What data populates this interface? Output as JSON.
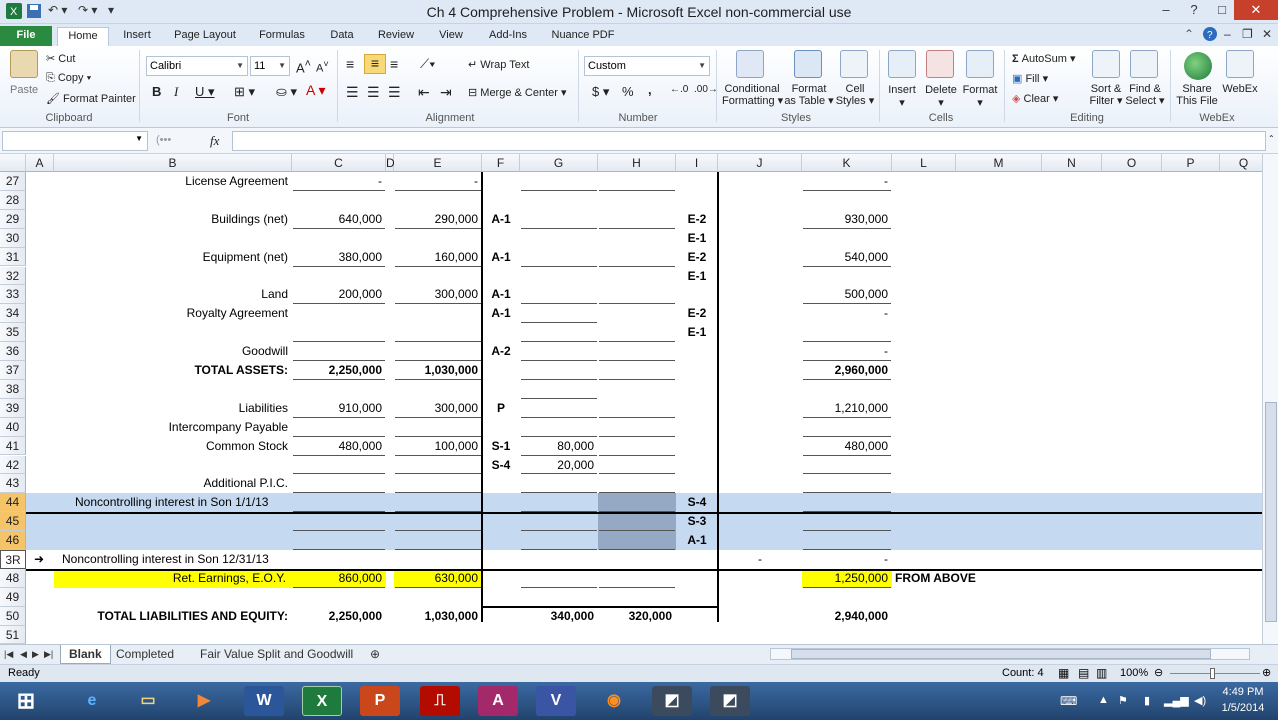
{
  "window": {
    "title": "Ch 4 Comprehensive Problem  -  Microsoft Excel non-commercial use",
    "controls": [
      "?",
      "–",
      "□",
      "✕"
    ]
  },
  "tabs": [
    "File",
    "Home",
    "Insert",
    "Page Layout",
    "Formulas",
    "Data",
    "Review",
    "View",
    "Add-Ins",
    "Nuance PDF"
  ],
  "ribbon": {
    "clipboard": {
      "paste": "Paste",
      "cut": "Cut",
      "copy": "Copy",
      "painter": "Format Painter",
      "label": "Clipboard"
    },
    "font": {
      "name": "Calibri",
      "size": "11",
      "label": "Font"
    },
    "alignment": {
      "wrap": "Wrap Text",
      "merge": "Merge & Center",
      "label": "Alignment"
    },
    "number": {
      "format": "Custom",
      "label": "Number",
      "currency": "$",
      "percent": "%",
      "comma": ","
    },
    "styles": {
      "cond1": "Conditional",
      "cond2": "Formatting",
      "table1": "Format",
      "table2": "as Table",
      "cell1": "Cell",
      "cell2": "Styles",
      "label": "Styles"
    },
    "cells": {
      "insert": "Insert",
      "delete": "Delete",
      "format": "Format",
      "label": "Cells"
    },
    "editing": {
      "autosum": "AutoSum",
      "fill": "Fill",
      "clear": "Clear",
      "sort1": "Sort &",
      "sort2": "Filter",
      "find1": "Find &",
      "find2": "Select",
      "label": "Editing"
    },
    "webex": {
      "share1": "Share",
      "share2": "This File",
      "webex": "WebEx",
      "label": "WebEx"
    }
  },
  "formula_bar": {
    "fx": "fx"
  },
  "columns": [
    "A",
    "B",
    "C",
    "D",
    "E",
    "F",
    "G",
    "H",
    "I",
    "J",
    "K",
    "L",
    "M",
    "N",
    "O",
    "P",
    "Q"
  ],
  "rows": [
    {
      "n": "27",
      "B": "License Agreement",
      "C": "-",
      "E": "-",
      "K": "-"
    },
    {
      "n": "28"
    },
    {
      "n": "29",
      "B": "Buildings (net)",
      "C": "640,000",
      "E": "290,000",
      "F": "A-1",
      "I": "E-2",
      "K": "930,000"
    },
    {
      "n": "30",
      "I": "E-1"
    },
    {
      "n": "31",
      "B": "Equipment (net)",
      "C": "380,000",
      "E": "160,000",
      "F": "A-1",
      "I": "E-2",
      "K": "540,000"
    },
    {
      "n": "32",
      "I": "E-1"
    },
    {
      "n": "33",
      "B": "Land",
      "C": "200,000",
      "E": "300,000",
      "F": "A-1",
      "K": "500,000"
    },
    {
      "n": "34",
      "B": "Royalty Agreement",
      "F": "A-1",
      "I": "E-2",
      "K": "-"
    },
    {
      "n": "35",
      "I": "E-1"
    },
    {
      "n": "36",
      "B": "Goodwill",
      "F": "A-2",
      "K": "-"
    },
    {
      "n": "37",
      "B": "TOTAL ASSETS:",
      "C": "2,250,000",
      "E": "1,030,000",
      "K": "2,960,000"
    },
    {
      "n": "38"
    },
    {
      "n": "39",
      "B": "Liabilities",
      "C": "910,000",
      "E": "300,000",
      "F": "P",
      "K": "1,210,000"
    },
    {
      "n": "40",
      "B": "Intercompany Payable"
    },
    {
      "n": "41",
      "B": "Common Stock",
      "C": "480,000",
      "E": "100,000",
      "F": "S-1",
      "G": "80,000",
      "K": "480,000"
    },
    {
      "n": "42",
      "F": "S-4",
      "G": "20,000"
    },
    {
      "n": "43",
      "B": "Additional P.I.C."
    },
    {
      "n": "44",
      "B": "Noncontrolling interest in Son 1/1/13",
      "I": "S-4"
    },
    {
      "n": "45",
      "I": "S-3"
    },
    {
      "n": "46",
      "I": "A-1"
    },
    {
      "n": "3R",
      "B": "Noncontrolling interest in Son 12/31/13",
      "J": "-",
      "K": "-"
    },
    {
      "n": "48",
      "B": "Ret. Earnings, E.O.Y.",
      "C": "860,000",
      "E": "630,000",
      "K": "1,250,000",
      "L": "FROM ABOVE"
    },
    {
      "n": "49"
    },
    {
      "n": "50",
      "B": "TOTAL LIABILITIES AND EQUITY:",
      "C": "2,250,000",
      "E": "1,030,000",
      "G": "340,000",
      "H": "320,000",
      "K": "2,940,000"
    },
    {
      "n": "51"
    }
  ],
  "sheets": [
    "Blank",
    "Completed",
    "Fair Value Split and Goodwill"
  ],
  "status": {
    "ready": "Ready",
    "count": "Count: 4",
    "zoom": "100%"
  },
  "clock": {
    "time": "4:49 PM",
    "date": "1/5/2014"
  },
  "colors": {
    "highlight_yellow": "#ffff00",
    "selection_blue": "#c5d9f1",
    "ribbon_green": "#2a8a3f"
  }
}
